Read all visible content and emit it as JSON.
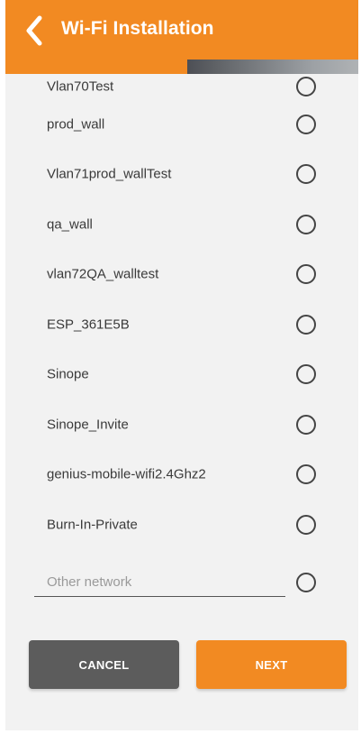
{
  "header": {
    "title": "Wi-Fi Installation",
    "back_icon": "chevron-left-icon",
    "color": "#f28a22"
  },
  "networks": [
    {
      "label": "Vlan70Test"
    },
    {
      "label": "prod_wall"
    },
    {
      "label": "Vlan71prod_wallTest"
    },
    {
      "label": "qa_wall"
    },
    {
      "label": "vlan72QA_walltest"
    },
    {
      "label": "ESP_361E5B"
    },
    {
      "label": "Sinope"
    },
    {
      "label": "Sinope_Invite"
    },
    {
      "label": "genius-mobile-wifi2.4Ghz2"
    },
    {
      "label": "Burn-In-Private"
    }
  ],
  "other_network": {
    "placeholder": "Other network",
    "value": ""
  },
  "buttons": {
    "cancel_label": "CANCEL",
    "next_label": "NEXT",
    "cancel_color": "#5c5c5c",
    "next_color": "#f28a22"
  }
}
